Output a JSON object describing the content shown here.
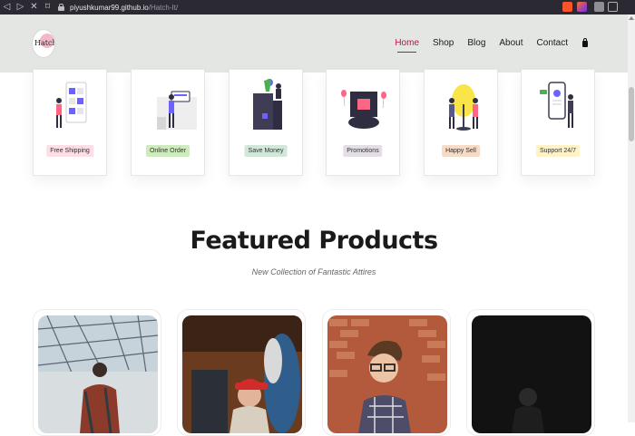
{
  "browser": {
    "url_host": "piyushkumar99.github.io",
    "url_path": "/Hatch-It/"
  },
  "header": {
    "logo_text": "Hatch",
    "menu": [
      {
        "label": "Home",
        "active": true
      },
      {
        "label": "Shop",
        "active": false
      },
      {
        "label": "Blog",
        "active": false
      },
      {
        "label": "About",
        "active": false
      },
      {
        "label": "Contact",
        "active": false
      }
    ],
    "cart_icon": "shopping-bag-icon",
    "accent_color": "#c4113f"
  },
  "features": [
    {
      "label": "Free Shipping",
      "bg": "#fddde6",
      "color": "#333"
    },
    {
      "label": "Online Order",
      "bg": "#cdebbc",
      "color": "#333"
    },
    {
      "label": "Save Money",
      "bg": "#d1e8d9",
      "color": "#333"
    },
    {
      "label": "Promotions",
      "bg": "#e3dde6",
      "color": "#333"
    },
    {
      "label": "Happy Sell",
      "bg": "#f6dbc7",
      "color": "#333"
    },
    {
      "label": "Support 24/7",
      "bg": "#fff2c6",
      "color": "#333"
    }
  ],
  "featured": {
    "title": "Featured Products",
    "subtitle": "New Collection of Fantastic Attires"
  },
  "products": [
    {
      "image": "man-in-plaid-shirt-under-glass-roof-photo"
    },
    {
      "image": "young-man-in-red-cap-photo"
    },
    {
      "image": "man-with-glasses-brick-wall-photo"
    },
    {
      "image": "man-in-dark-background-photo"
    }
  ]
}
